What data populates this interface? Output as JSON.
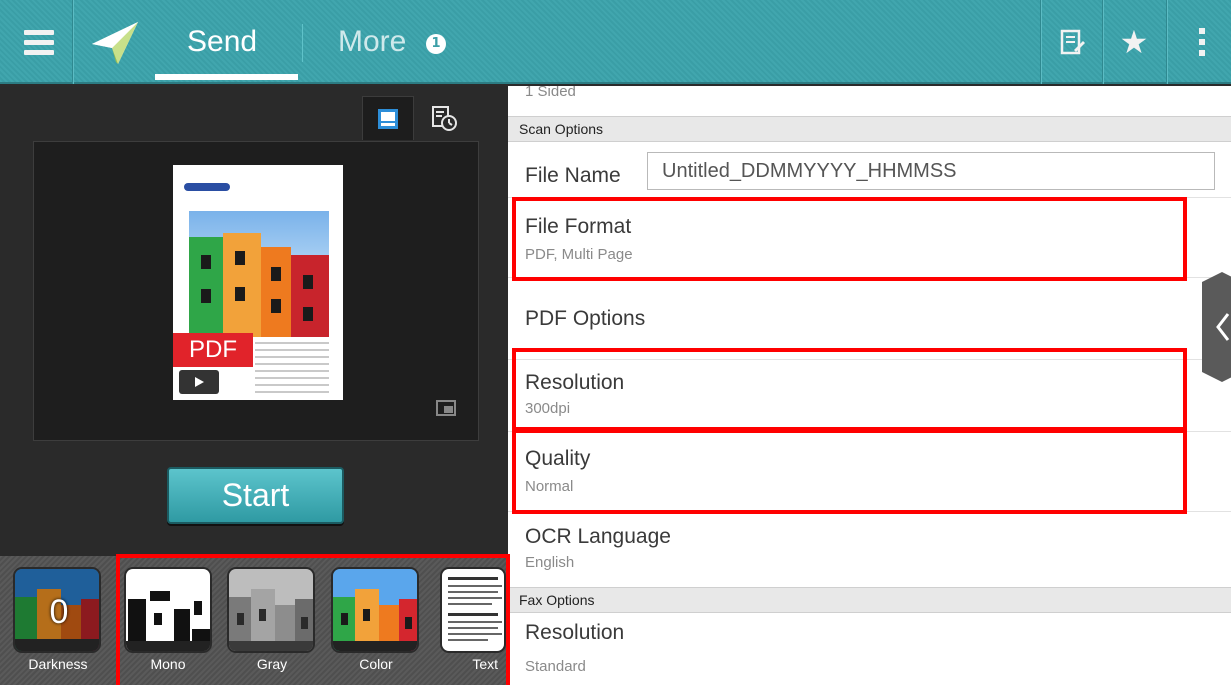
{
  "topbar": {
    "tabs": [
      {
        "label": "Send",
        "active": true
      },
      {
        "label": "More",
        "badge": "1"
      }
    ],
    "icons": [
      "menu-icon",
      "send-plane-icon",
      "edit-list-icon",
      "star-icon",
      "overflow-menu-icon"
    ]
  },
  "preview": {
    "view_tabs": [
      "image-preview-icon",
      "scheduled-preview-icon"
    ],
    "file_badge": "PDF",
    "start_label": "Start"
  },
  "color_modes": {
    "darkness_value": "0",
    "items": [
      {
        "label": "Darkness"
      },
      {
        "label": "Mono"
      },
      {
        "label": "Gray"
      },
      {
        "label": "Color"
      },
      {
        "label": "Text"
      }
    ]
  },
  "settings": {
    "top_partial_sub": "1 Sided",
    "scan_section": "Scan Options",
    "file_name": {
      "label": "File Name",
      "value": "Untitled_DDMMYYYY_HHMMSS"
    },
    "file_format": {
      "label": "File Format",
      "value": "PDF, Multi Page"
    },
    "pdf_options": {
      "label": "PDF Options"
    },
    "resolution": {
      "label": "Resolution",
      "value": "300dpi"
    },
    "quality": {
      "label": "Quality",
      "value": "Normal"
    },
    "ocr_language": {
      "label": "OCR Language",
      "value": "English"
    },
    "fax_section": "Fax Options",
    "fax_resolution": {
      "label": "Resolution",
      "value": "Standard"
    }
  },
  "colors": {
    "accent": "#41a6ae",
    "highlight": "#ff0000",
    "start_button": "#3aa9b1"
  }
}
